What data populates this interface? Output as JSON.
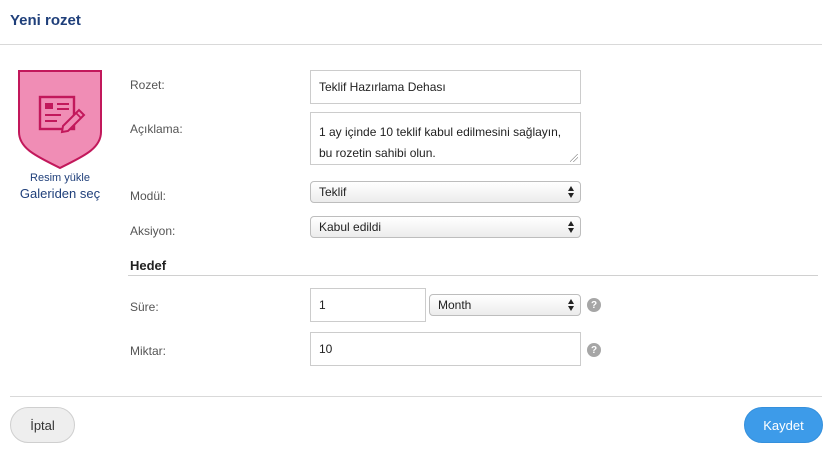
{
  "header": {
    "title": "Yeni rozet"
  },
  "badge": {
    "icon": "certificate-edit-icon",
    "upload_label": "Resim yükle",
    "gallery_label": "Galeriden seç",
    "colors": {
      "fill": "#f08db5",
      "border": "#c2185b"
    }
  },
  "form": {
    "badge_name": {
      "label": "Rozet:",
      "value": "Teklif Hazırlama Dehası"
    },
    "description": {
      "label": "Açıklama:",
      "line1": "1 ay içinde 10 teklif kabul edilmesini sağlayın,",
      "line2": "bu rozetin sahibi olun."
    },
    "module": {
      "label": "Modül:",
      "selected": "Teklif"
    },
    "action": {
      "label": "Aksiyon:",
      "selected": "Kabul edildi"
    }
  },
  "goal": {
    "section_title": "Hedef",
    "duration": {
      "label": "Süre:",
      "value": "1",
      "unit": "Month",
      "help_icon": "?"
    },
    "amount": {
      "label": "Miktar:",
      "value": "10",
      "help_icon": "?"
    }
  },
  "footer": {
    "cancel_label": "İptal",
    "save_label": "Kaydet"
  },
  "colors": {
    "primary": "#3d9be9",
    "title": "#1f3f7a"
  }
}
